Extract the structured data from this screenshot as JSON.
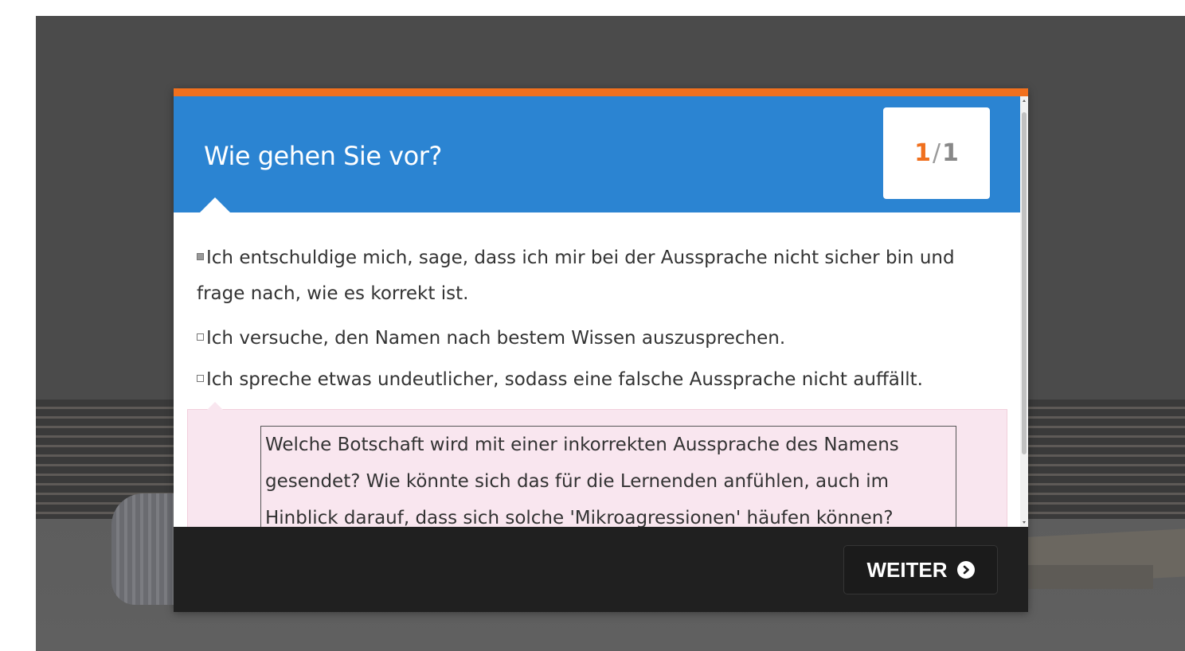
{
  "header": {
    "title": "Wie gehen Sie vor?"
  },
  "counter": {
    "current": "1",
    "separator": "/",
    "total": "1"
  },
  "options": [
    {
      "label": "Ich entschuldige mich, sage, dass ich mir bei der Aussprache nicht sicher bin und frage nach, wie es korrekt ist.",
      "checked": true
    },
    {
      "label": "Ich versuche, den Namen nach bestem Wissen auszusprechen.",
      "checked": false
    },
    {
      "label": "Ich spreche etwas undeutlicher, sodass eine falsche Aussprache nicht auffällt.",
      "checked": false
    }
  ],
  "feedback": {
    "text": "Welche Botschaft wird mit einer inkorrekten Aussprache des Namens gesendet? Wie könnte sich das für die Lernenden anfühlen, auch im Hinblick darauf, dass sich solche 'Mikroagressionen' häufen können?"
  },
  "footer": {
    "next_label": "WEITER",
    "next_icon": "chevron-circle-right-icon"
  },
  "colors": {
    "accent": "#f0701e",
    "header": "#2b84d2",
    "feedback_bg": "#f9e6ef",
    "footer": "#202020"
  }
}
